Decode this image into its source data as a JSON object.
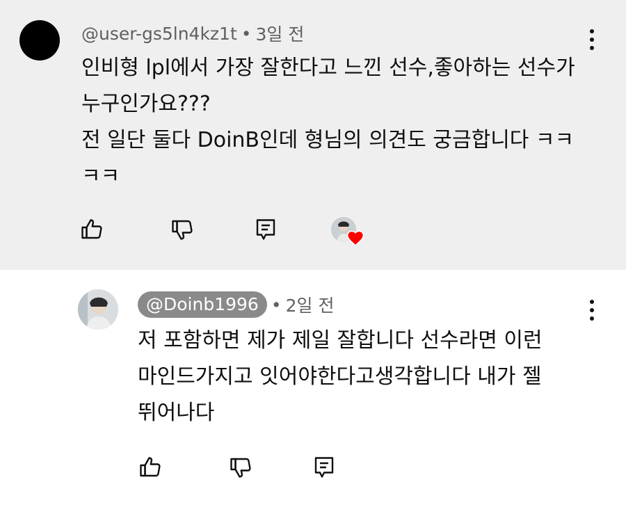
{
  "comments": [
    {
      "handle": "@user-gs5ln4kz1t",
      "separator": "•",
      "time": "3일 전",
      "lines": [
        "인비형 lpl에서 가장 잘한다고 느낀 선수,좋아하는 선수가",
        "누구인가요???",
        "전 일단 둘다 DoinB인데 형님의 의견도 궁금합니다 ㅋㅋ",
        "ㅋㅋ"
      ],
      "icons": [
        "like-icon",
        "dislike-icon",
        "reply-icon",
        "creator-heart-icon",
        "more-vert-icon"
      ]
    },
    {
      "handle": "@Doinb1996",
      "separator": "•",
      "time": "2일 전",
      "lines": [
        "저 포함하면 제가 제일 잘합니다 선수라면 이런",
        "마인드가지고 잇어야한다고생각합니다 내가 젤",
        "뛰어나다"
      ],
      "icons": [
        "like-icon",
        "dislike-icon",
        "reply-icon",
        "more-vert-icon"
      ]
    }
  ],
  "colors": {
    "highlight_background": "#efefef",
    "secondary_text": "#606060",
    "handle_pill": "#8a8a8a",
    "heart": "#ff0000"
  }
}
